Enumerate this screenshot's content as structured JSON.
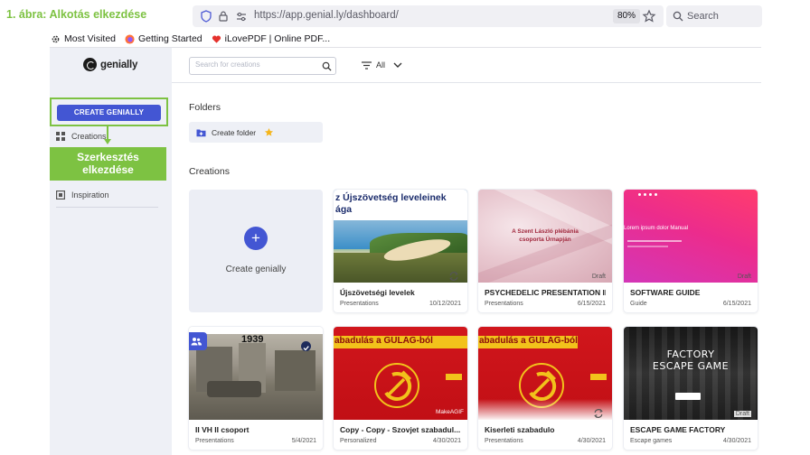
{
  "caption": "1. ábra: Alkotás elkezdése",
  "browser": {
    "url_scheme": "https://",
    "url_host": "app.genial.ly",
    "url_path": "/dashboard/",
    "zoom": "80%",
    "search_label": "Search",
    "bookmarks": [
      {
        "label": "Most Visited",
        "icon": "gear-icon"
      },
      {
        "label": "Getting Started",
        "icon": "firefox-icon"
      },
      {
        "label": "iLovePDF | Online PDF...",
        "icon": "heart-icon"
      }
    ]
  },
  "sidebar": {
    "logo": "genially",
    "create_button": "CREATE GENIALLY",
    "items": [
      {
        "label": "Creations",
        "icon": "grid-icon"
      },
      {
        "label": "Inspiration",
        "icon": "inspiration-icon"
      }
    ]
  },
  "annotation": {
    "line1": "Szerkesztés",
    "line2": "elkezdése"
  },
  "main": {
    "search_placeholder": "Search for creations",
    "filter_label": "All",
    "folders_title": "Folders",
    "create_folder": "Create folder",
    "creations_title": "Creations",
    "create_genially": "Create genially",
    "cards": [
      {
        "title": "Újszövetségi levelek",
        "type": "Presentations",
        "date": "10/12/2021",
        "thumb_text": "z Újszövetség leveleinek\nága"
      },
      {
        "title": "PSYCHEDELIC PRESENTATION II",
        "type": "Presentations",
        "date": "6/15/2021",
        "status": "Draft",
        "thumb_text": "A Szent László plébánia\ncsoporta Úrnapján"
      },
      {
        "title": "SOFTWARE GUIDE",
        "type": "Guide",
        "date": "6/15/2021",
        "status": "Draft",
        "thumb_text": "Lorem ipsum dolor Manual"
      },
      {
        "title": "II VH II csoport",
        "type": "Presentations",
        "date": "5/4/2021",
        "thumb_text": "1939"
      },
      {
        "title": "Copy - Copy - Szovjet szabadul...",
        "type": "Personalized",
        "date": "4/30/2021",
        "thumb_text": "abadulás a GULAG-ból",
        "thumb_sub": "MakeAGIF"
      },
      {
        "title": "Kiserleti szabadulo",
        "type": "Presentations",
        "date": "4/30/2021",
        "thumb_text": "abadulás a GULAG-ból"
      },
      {
        "title": "ESCAPE GAME FACTORY",
        "type": "Escape games",
        "date": "4/30/2021",
        "status": "Draft",
        "thumb_text": "FACTORY\nESCAPE GAME"
      }
    ]
  }
}
